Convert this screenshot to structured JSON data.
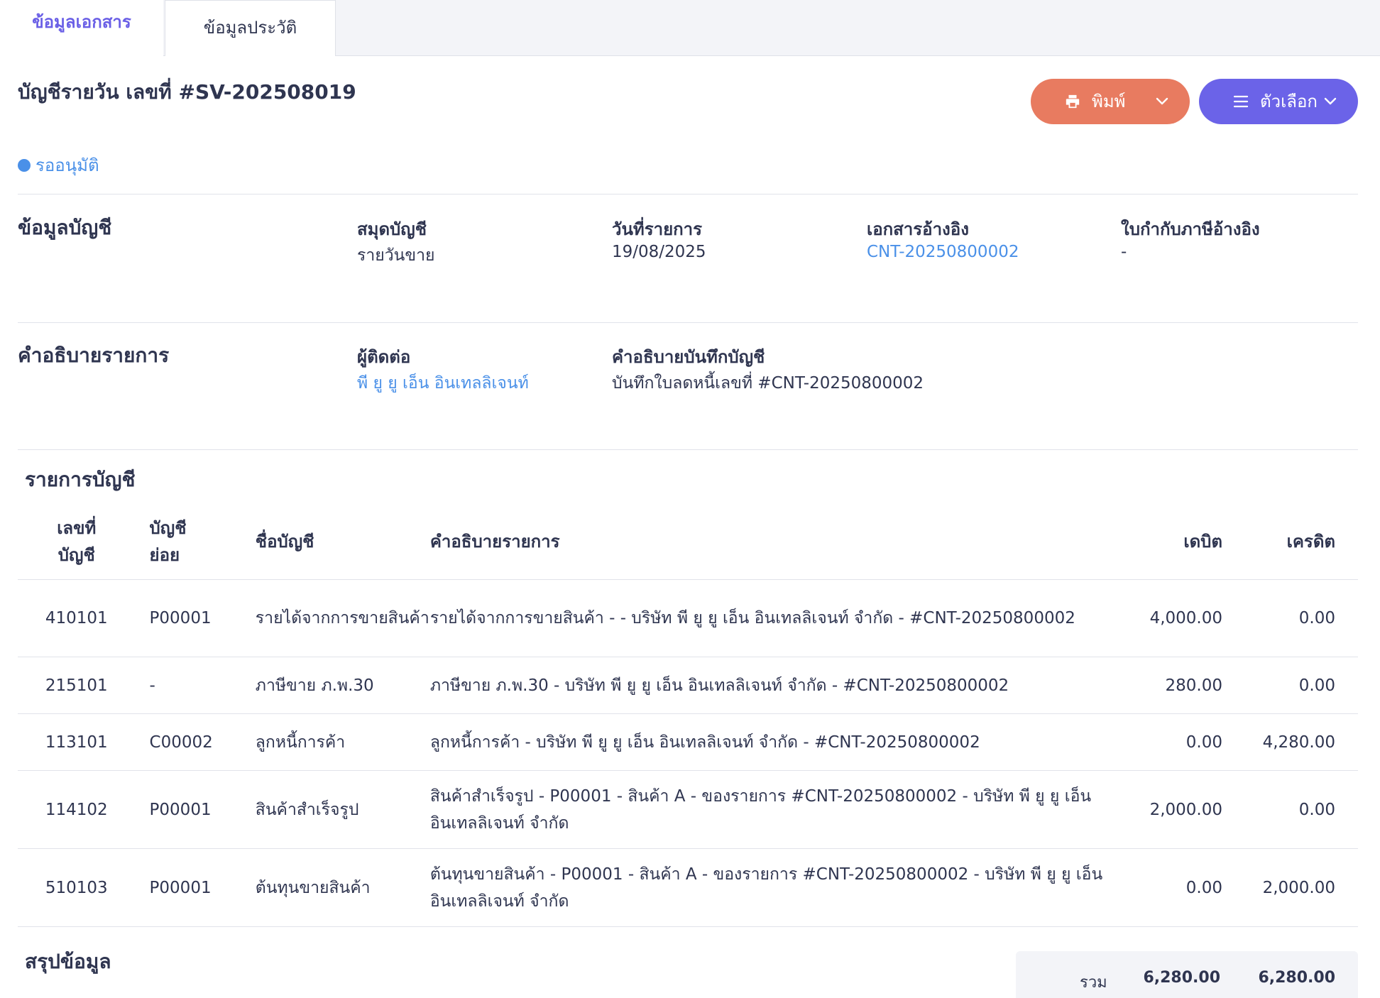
{
  "tabs": {
    "active": "ข้อมูลเอกสาร",
    "inactive": "ข้อมูลประวัติ"
  },
  "header": {
    "title": "บัญชีรายวัน เลขที่ #SV-202508019",
    "print_label": "พิมพ์",
    "options_label": "ตัวเลือก"
  },
  "status": {
    "label": "รออนุมัติ",
    "color": "#4a90e8"
  },
  "account_info": {
    "section_title": "ข้อมูลบัญชี",
    "book_label": "สมุดบัญชี",
    "book_value": "รายวันขาย",
    "date_label": "วันที่รายการ",
    "date_value": "19/08/2025",
    "ref_label": "เอกสารอ้างอิง",
    "ref_value": "CNT-20250800002",
    "tax_label": "ใบกำกับภาษีอ้างอิง",
    "tax_value": "-"
  },
  "description": {
    "section_title": "คำอธิบายรายการ",
    "contact_label": "ผู้ติดต่อ",
    "contact_value": "พี ยู ยู เอ็น อินเทลลิเจนท์",
    "memo_label": "คำอธิบายบันทึกบัญชี",
    "memo_value": "บันทึกใบลดหนี้เลขที่ #CNT-20250800002"
  },
  "entries": {
    "section_title": "รายการบัญชี",
    "headers": {
      "account_no_1": "เลขที่",
      "account_no_2": "บัญชี",
      "sub_1": "บัญชี",
      "sub_2": "ย่อย",
      "name": "ชื่อบัญชี",
      "desc": "คำอธิบายรายการ",
      "debit": "เดบิต",
      "credit": "เครดิต"
    },
    "rows": [
      {
        "account": "410101",
        "sub": "P00001",
        "name": "รายได้จากการขายสินค้า",
        "desc": "รายได้จากการขายสินค้า - - บริษัท พี ยู ยู เอ็น อินเทลลิเจนท์ จำกัด - #CNT-20250800002",
        "debit": "4,000.00",
        "credit": "0.00"
      },
      {
        "account": "215101",
        "sub": "-",
        "name": "ภาษีขาย ภ.พ.30",
        "desc": "ภาษีขาย ภ.พ.30 - บริษัท พี ยู ยู เอ็น อินเทลลิเจนท์ จำกัด - #CNT-20250800002",
        "debit": "280.00",
        "credit": "0.00"
      },
      {
        "account": "113101",
        "sub": "C00002",
        "name": "ลูกหนี้การค้า",
        "desc": "ลูกหนี้การค้า - บริษัท พี ยู ยู เอ็น อินเทลลิเจนท์ จำกัด - #CNT-20250800002",
        "debit": "0.00",
        "credit": "4,280.00"
      },
      {
        "account": "114102",
        "sub": "P00001",
        "name": "สินค้าสำเร็จรูป",
        "desc": "สินค้าสำเร็จรูป - P00001 - สินค้า A - ของรายการ #CNT-20250800002 - บริษัท พี ยู ยู เอ็น อินเทลลิเจนท์ จำกัด",
        "debit": "2,000.00",
        "credit": "0.00"
      },
      {
        "account": "510103",
        "sub": "P00001",
        "name": "ต้นทุนขายสินค้า",
        "desc": "ต้นทุนขายสินค้า - P00001 - สินค้า A - ของรายการ #CNT-20250800002 - บริษัท พี ยู ยู เอ็น อินเทลลิเจนท์ จำกัด",
        "debit": "0.00",
        "credit": "2,000.00"
      }
    ]
  },
  "summary": {
    "section_title": "สรุปข้อมูล",
    "total_label": "รวม",
    "total_debit": "6,280.00",
    "total_credit": "6,280.00"
  }
}
